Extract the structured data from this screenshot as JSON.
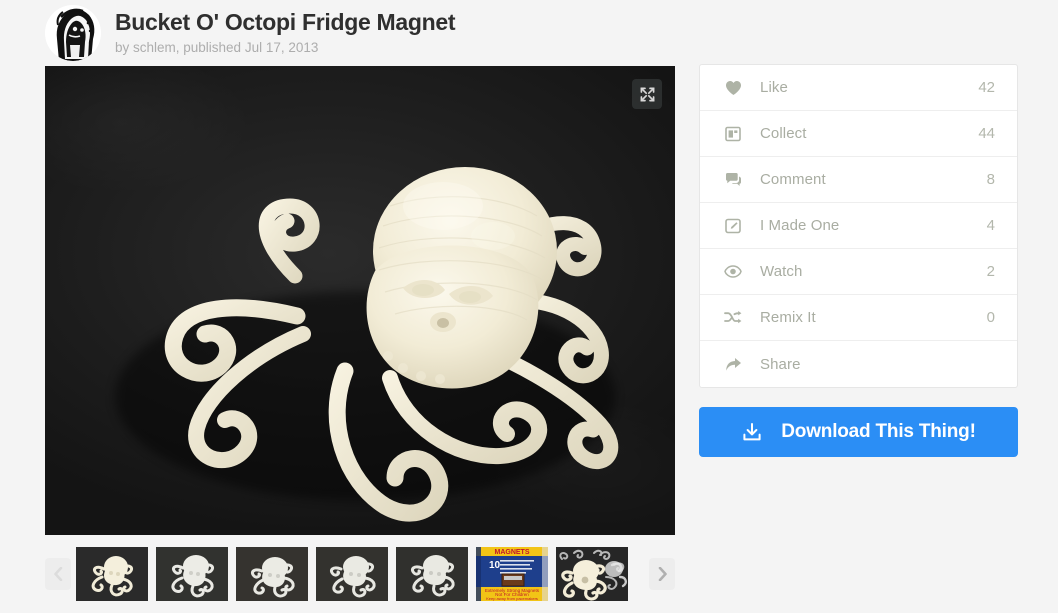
{
  "header": {
    "title": "Bucket O' Octopi Fridge Magnet",
    "byline": "by schlem, published Jul 17, 2013",
    "avatar_icon": "user-portrait-avatar"
  },
  "main_image": {
    "alt": "3D printed cream colored octopus on dark background",
    "expand_icon": "expand-fullscreen-icon"
  },
  "thumbnails": {
    "prev_icon": "chevron-left-icon",
    "next_icon": "chevron-right-icon",
    "items": [
      {
        "name": "octopus-photo-1",
        "kind": "octopus-cream-dark"
      },
      {
        "name": "octopus-photo-2",
        "kind": "octopus-white-dark"
      },
      {
        "name": "octopus-photo-3",
        "kind": "octopus-white-dark"
      },
      {
        "name": "octopus-photo-4",
        "kind": "octopus-white-dark"
      },
      {
        "name": "octopus-photo-5",
        "kind": "octopus-white-dark"
      },
      {
        "name": "magnets-package-photo",
        "kind": "magnets-package"
      },
      {
        "name": "octopi-group-photo",
        "kind": "octopi-group"
      }
    ]
  },
  "sidebar": {
    "actions": [
      {
        "icon": "heart-icon",
        "label": "Like",
        "count": "42"
      },
      {
        "icon": "collect-icon",
        "label": "Collect",
        "count": "44"
      },
      {
        "icon": "comment-icon",
        "label": "Comment",
        "count": "8"
      },
      {
        "icon": "made-one-icon",
        "label": "I Made One",
        "count": "4"
      },
      {
        "icon": "eye-icon",
        "label": "Watch",
        "count": "2"
      },
      {
        "icon": "shuffle-icon",
        "label": "Remix It",
        "count": "0"
      },
      {
        "icon": "share-icon",
        "label": "Share",
        "count": ""
      }
    ],
    "download": {
      "label": "Download This Thing!",
      "icon": "download-icon",
      "color": "#2b8ef5"
    }
  },
  "colors": {
    "page_bg": "#f4f4f4",
    "accent_blue": "#2b8ef5",
    "title_text": "#2f2f2f",
    "muted_text": "#a9ada2",
    "byline_text": "#adadad",
    "photo_bg": "#1c1c1c",
    "octopus": "#f5efdc"
  }
}
